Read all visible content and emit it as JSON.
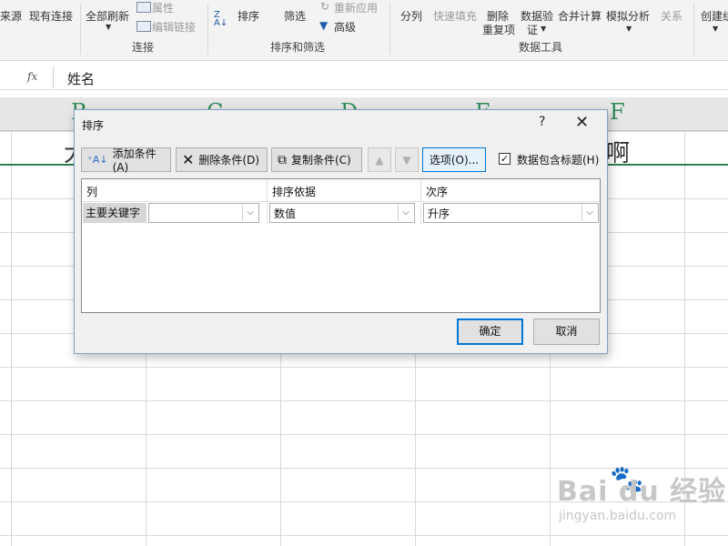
{
  "ribbon": {
    "items": {
      "from_source": "来源",
      "existing_connections": "现有连接",
      "refresh_all": "全部刷新",
      "properties": "属性",
      "edit_links": "编辑链接",
      "sort": "排序",
      "filter": "筛选",
      "reapply": "重新应用",
      "advanced": "高级",
      "text_to_columns": "分列",
      "flash_fill": "快速填充",
      "remove_dup_1": "删除",
      "remove_dup_2": "重复项",
      "data_validation_1": "数据验",
      "data_validation_2": "证",
      "consolidate": "合并计算",
      "what_if": "模拟分析",
      "relationships": "关系",
      "create_group": "创建组"
    },
    "groups": {
      "connections": "连接",
      "sort_filter": "排序和筛选",
      "data_tools": "数据工具"
    }
  },
  "formula_bar": {
    "fx": "fx",
    "value": "姓名"
  },
  "sheet": {
    "columns": [
      "B",
      "C",
      "D",
      "E",
      "F"
    ],
    "cells": {
      "row2_left": "大",
      "row2_right": "啊"
    }
  },
  "dialog": {
    "title": "排序",
    "help": "?",
    "close": "✕",
    "toolbar": {
      "add_condition": "添加条件(A)",
      "delete_condition": "删除条件(D)",
      "copy_condition": "复制条件(C)",
      "move_up": "▲",
      "move_down": "▼",
      "options": "选项(O)..."
    },
    "has_headers": {
      "label": "数据包含标题(H)",
      "checked": true
    },
    "table": {
      "headers": [
        "列",
        "排序依据",
        "次序"
      ],
      "row": {
        "label": "主要关键字",
        "column_value": "",
        "sort_on": "数值",
        "order": "升序"
      }
    },
    "ok": "确定",
    "cancel": "取消"
  },
  "watermark": {
    "main": "Bai du 经验",
    "sub": "jingyan.baidu.com"
  }
}
